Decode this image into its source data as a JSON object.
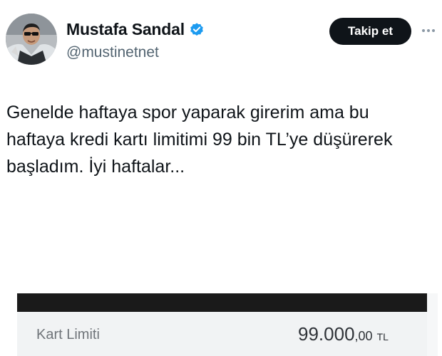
{
  "author": {
    "display_name": "Mustafa Sandal",
    "handle": "@mustinetnet",
    "verified_icon": "verified-badge-icon",
    "accent_color": "#1d9bf0"
  },
  "actions": {
    "follow_label": "Takip et",
    "more_icon": "more-horizontal-icon"
  },
  "tweet": {
    "lines": [
      "Genelde haftaya spor yaparak girerim ama bu",
      "haftaya kredi kartı limitimi 99 bin TL’ye düşürerek",
      "başladım. İyi haftalar..."
    ]
  },
  "media_card": {
    "label": "Kart Limiti",
    "amount_main": "99.000",
    "amount_decimal": ",00",
    "currency": "TL"
  },
  "colors": {
    "text": "#0f1419",
    "secondary_text": "#536471",
    "button_bg": "#0f1419",
    "button_text": "#ffffff"
  }
}
